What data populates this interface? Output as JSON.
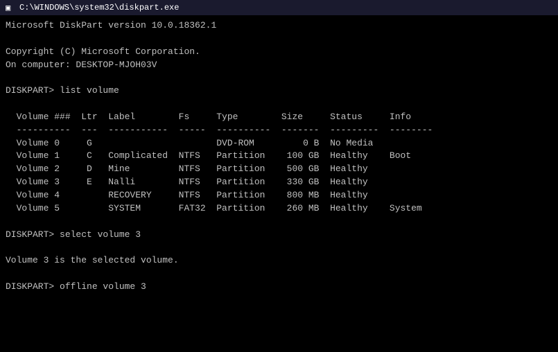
{
  "titleBar": {
    "icon": "▣",
    "title": "C:\\WINDOWS\\system32\\diskpart.exe"
  },
  "console": {
    "lines": [
      "Microsoft DiskPart version 10.0.18362.1",
      "",
      "Copyright (C) Microsoft Corporation.",
      "On computer: DESKTOP-MJOH03V",
      "",
      "DISKPART> list volume",
      "",
      "  Volume ###  Ltr  Label        Fs     Type        Size     Status     Info",
      "  ----------  ---  -----------  -----  ----------  -------  ---------  --------",
      "  Volume 0     G                       DVD-ROM         0 B  No Media",
      "  Volume 1     C   Complicated  NTFS   Partition    100 GB  Healthy    Boot",
      "  Volume 2     D   Mine         NTFS   Partition    500 GB  Healthy",
      "  Volume 3     E   Nalli        NTFS   Partition    330 GB  Healthy",
      "  Volume 4         RECOVERY     NTFS   Partition    800 MB  Healthy",
      "  Volume 5         SYSTEM       FAT32  Partition    260 MB  Healthy    System",
      "",
      "DISKPART> select volume 3",
      "",
      "Volume 3 is the selected volume.",
      "",
      "DISKPART> offline volume 3"
    ]
  }
}
